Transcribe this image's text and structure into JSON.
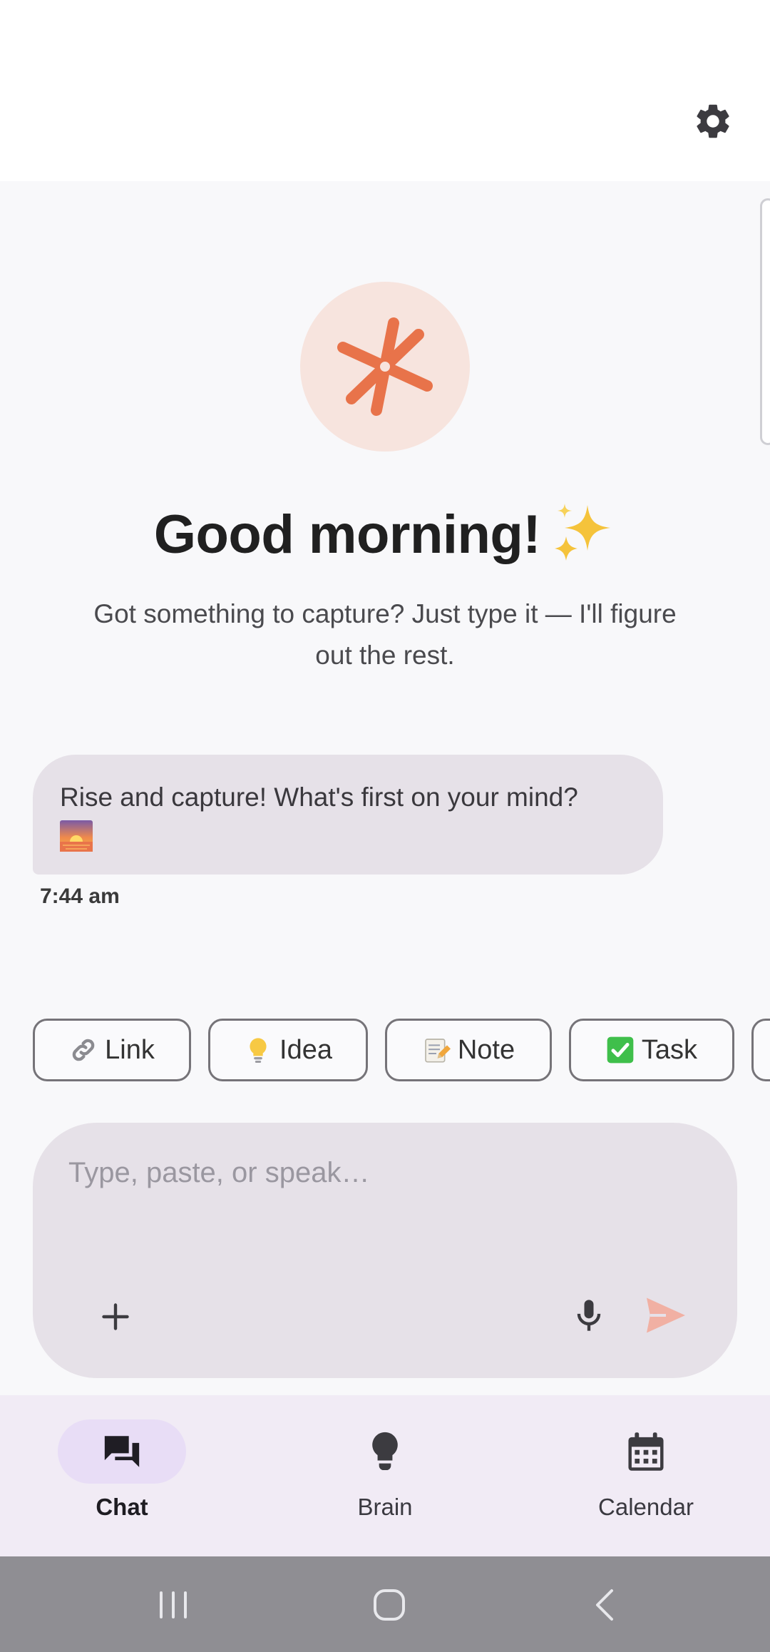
{
  "colors": {
    "accent": "#e8734a",
    "avatar_bg": "#f7e4de",
    "bubble_bg": "#e6e1e8",
    "nav_bg": "#f1ebf5",
    "nav_active_pill": "#e8ddf6",
    "system_nav_bg": "#8f8e93"
  },
  "header": {
    "settings_icon": "gear-icon"
  },
  "hero": {
    "logo_icon": "asterisk-logo-icon",
    "greeting": "Good morning!",
    "greeting_icon": "sparkles-icon",
    "subtitle": "Got something to capture? Just type it — I'll figure out the rest."
  },
  "chat": {
    "messages": [
      {
        "text": "Rise and capture! What's first on your mind?",
        "emoji_icon": "sunrise-icon",
        "time": "7:44 am"
      }
    ]
  },
  "chips": [
    {
      "label": "Link",
      "icon": "link-icon"
    },
    {
      "label": "Idea",
      "icon": "lightbulb-icon"
    },
    {
      "label": "Note",
      "icon": "memo-icon"
    },
    {
      "label": "Task",
      "icon": "check-box-icon"
    }
  ],
  "composer": {
    "placeholder": "Type, paste, or speak…",
    "add_icon": "plus-icon",
    "mic_icon": "microphone-icon",
    "send_icon": "send-icon"
  },
  "nav": {
    "items": [
      {
        "label": "Chat",
        "icon": "chat-icon",
        "active": true
      },
      {
        "label": "Brain",
        "icon": "lightbulb-icon",
        "active": false
      },
      {
        "label": "Calendar",
        "icon": "calendar-icon",
        "active": false
      }
    ]
  },
  "system_nav": {
    "recents_icon": "recents-icon",
    "home_icon": "home-icon",
    "back_icon": "back-icon"
  }
}
